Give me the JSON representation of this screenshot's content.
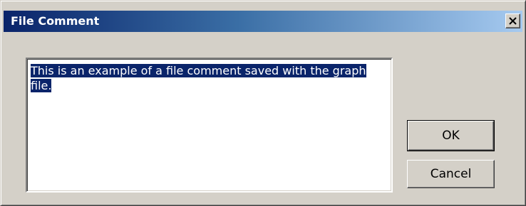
{
  "window": {
    "title": "File Comment",
    "close_icon": "close-icon"
  },
  "comment": {
    "text": "This is an example of a file comment saved with the graph file.",
    "selected": true,
    "selection_color": "#0a246a"
  },
  "buttons": {
    "ok_label": "OK",
    "cancel_label": "Cancel"
  },
  "colors": {
    "title_gradient_start": "#0a246a",
    "title_gradient_end": "#a6caf0",
    "dialog_face": "#d4d0c8"
  }
}
